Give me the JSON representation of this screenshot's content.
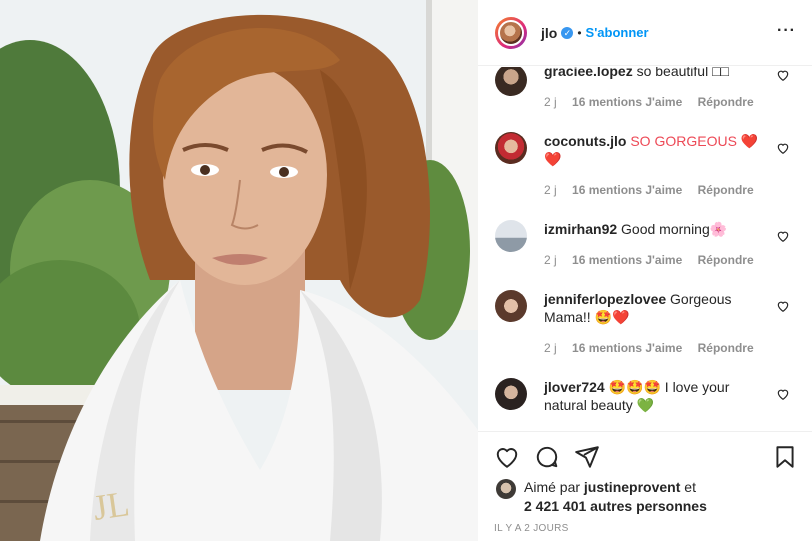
{
  "header": {
    "username": "jlo",
    "separator": "•",
    "follow_label": "S'abonner",
    "more_label": "···"
  },
  "comments": [
    {
      "username": "graciee.lopez",
      "text": "so beautiful □□",
      "time": "2 j",
      "likes": "16 mentions J'aime",
      "reply": "Répondre"
    },
    {
      "username": "coconuts.jlo",
      "text": "SO GORGEOUS ❤️ ❤️",
      "time": "2 j",
      "likes": "16 mentions J'aime",
      "reply": "Répondre"
    },
    {
      "username": "izmirhan92",
      "text": "Good morning🌸",
      "time": "2 j",
      "likes": "16 mentions J'aime",
      "reply": "Répondre"
    },
    {
      "username": "jenniferlopezlovee",
      "text": "Gorgeous Mama!! 🤩❤️",
      "time": "2 j",
      "likes": "16 mentions J'aime",
      "reply": "Répondre"
    },
    {
      "username": "jlover724",
      "text": "🤩🤩🤩 I love your natural beauty 💚",
      "time": "",
      "likes": "",
      "reply": ""
    }
  ],
  "likes": {
    "prefix": "Aimé par",
    "user": "justineprovent",
    "suffix": "et",
    "count": "2 421 401 autres personnes"
  },
  "timestamp": "IL Y A 2 JOURS",
  "colors": {
    "accent": "#0095f6",
    "verified": "#3897f0",
    "muted": "#8e8e8e"
  },
  "icons": [
    "heart-icon",
    "comment-icon",
    "share-icon",
    "bookmark-icon",
    "verified-badge-icon"
  ]
}
